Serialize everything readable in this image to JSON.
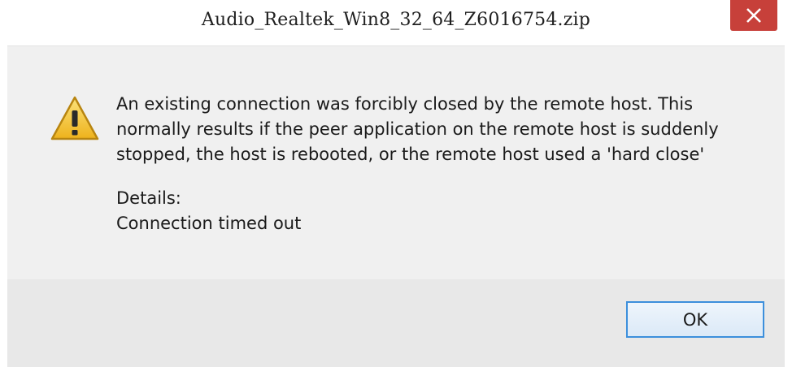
{
  "window": {
    "title": "Audio_Realtek_Win8_32_64_Z6016754.zip"
  },
  "titlebar": {
    "close_icon": "close-icon",
    "close_color": "#c7403a"
  },
  "dialog": {
    "icon": "warning-icon",
    "message": "An existing connection was forcibly closed by the remote host. This normally results if the peer application on the remote host is suddenly stopped, the host is rebooted, or the remote host used a 'hard close'",
    "details_label": "Details:",
    "details_value": "Connection timed out"
  },
  "buttons": {
    "ok_label": "OK"
  },
  "colors": {
    "accent": "#3c8fdc",
    "warning": "#f2c12e"
  }
}
